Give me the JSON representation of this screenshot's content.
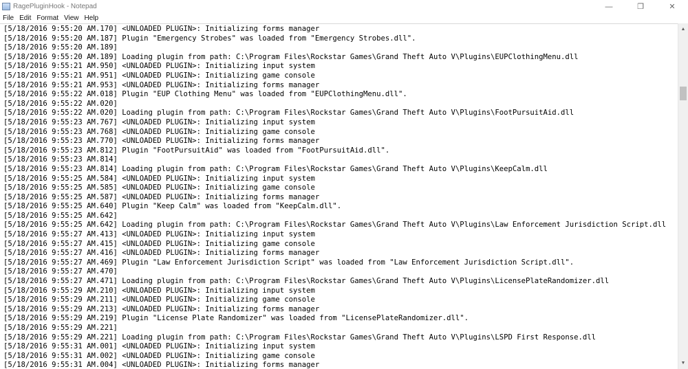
{
  "window": {
    "title": "RagePluginHook - Notepad",
    "minimize_icon": "minimize-icon",
    "maximize_icon": "restore-icon",
    "close_icon": "close-icon",
    "minimize_glyph": "—",
    "maximize_glyph": "❐",
    "close_glyph": "✕"
  },
  "menu": [
    "File",
    "Edit",
    "Format",
    "View",
    "Help"
  ],
  "scrollbar": {
    "up_glyph": "▲",
    "down_glyph": "▼"
  },
  "editor": {
    "lines": [
      "[5/18/2016 9:55:20 AM.170] <UNLOADED PLUGIN>: Initializing forms manager",
      "[5/18/2016 9:55:20 AM.187] Plugin \"Emergency Strobes\" was loaded from \"Emergency Strobes.dll\".",
      "[5/18/2016 9:55:20 AM.189]",
      "[5/18/2016 9:55:20 AM.189] Loading plugin from path: C:\\Program Files\\Rockstar Games\\Grand Theft Auto V\\Plugins\\EUPClothingMenu.dll",
      "[5/18/2016 9:55:21 AM.950] <UNLOADED PLUGIN>: Initializing input system",
      "[5/18/2016 9:55:21 AM.951] <UNLOADED PLUGIN>: Initializing game console",
      "[5/18/2016 9:55:21 AM.953] <UNLOADED PLUGIN>: Initializing forms manager",
      "[5/18/2016 9:55:22 AM.018] Plugin \"EUP Clothing Menu\" was loaded from \"EUPClothingMenu.dll\".",
      "[5/18/2016 9:55:22 AM.020]",
      "[5/18/2016 9:55:22 AM.020] Loading plugin from path: C:\\Program Files\\Rockstar Games\\Grand Theft Auto V\\Plugins\\FootPursuitAid.dll",
      "[5/18/2016 9:55:23 AM.767] <UNLOADED PLUGIN>: Initializing input system",
      "[5/18/2016 9:55:23 AM.768] <UNLOADED PLUGIN>: Initializing game console",
      "[5/18/2016 9:55:23 AM.770] <UNLOADED PLUGIN>: Initializing forms manager",
      "[5/18/2016 9:55:23 AM.812] Plugin \"FootPursuitAid\" was loaded from \"FootPursuitAid.dll\".",
      "[5/18/2016 9:55:23 AM.814]",
      "[5/18/2016 9:55:23 AM.814] Loading plugin from path: C:\\Program Files\\Rockstar Games\\Grand Theft Auto V\\Plugins\\KeepCalm.dll",
      "[5/18/2016 9:55:25 AM.584] <UNLOADED PLUGIN>: Initializing input system",
      "[5/18/2016 9:55:25 AM.585] <UNLOADED PLUGIN>: Initializing game console",
      "[5/18/2016 9:55:25 AM.587] <UNLOADED PLUGIN>: Initializing forms manager",
      "[5/18/2016 9:55:25 AM.640] Plugin \"Keep Calm\" was loaded from \"KeepCalm.dll\".",
      "[5/18/2016 9:55:25 AM.642]",
      "[5/18/2016 9:55:25 AM.642] Loading plugin from path: C:\\Program Files\\Rockstar Games\\Grand Theft Auto V\\Plugins\\Law Enforcement Jurisdiction Script.dll",
      "[5/18/2016 9:55:27 AM.413] <UNLOADED PLUGIN>: Initializing input system",
      "[5/18/2016 9:55:27 AM.415] <UNLOADED PLUGIN>: Initializing game console",
      "[5/18/2016 9:55:27 AM.416] <UNLOADED PLUGIN>: Initializing forms manager",
      "[5/18/2016 9:55:27 AM.469] Plugin \"Law Enforcement Jurisdiction Script\" was loaded from \"Law Enforcement Jurisdiction Script.dll\".",
      "[5/18/2016 9:55:27 AM.470]",
      "[5/18/2016 9:55:27 AM.471] Loading plugin from path: C:\\Program Files\\Rockstar Games\\Grand Theft Auto V\\Plugins\\LicensePlateRandomizer.dll",
      "[5/18/2016 9:55:29 AM.210] <UNLOADED PLUGIN>: Initializing input system",
      "[5/18/2016 9:55:29 AM.211] <UNLOADED PLUGIN>: Initializing game console",
      "[5/18/2016 9:55:29 AM.213] <UNLOADED PLUGIN>: Initializing forms manager",
      "[5/18/2016 9:55:29 AM.219] Plugin \"License Plate Randomizer\" was loaded from \"LicensePlateRandomizer.dll\".",
      "[5/18/2016 9:55:29 AM.221]",
      "[5/18/2016 9:55:29 AM.221] Loading plugin from path: C:\\Program Files\\Rockstar Games\\Grand Theft Auto V\\Plugins\\LSPD First Response.dll",
      "[5/18/2016 9:55:31 AM.001] <UNLOADED PLUGIN>: Initializing input system",
      "[5/18/2016 9:55:31 AM.002] <UNLOADED PLUGIN>: Initializing game console",
      "[5/18/2016 9:55:31 AM.004] <UNLOADED PLUGIN>: Initializing forms manager"
    ]
  }
}
